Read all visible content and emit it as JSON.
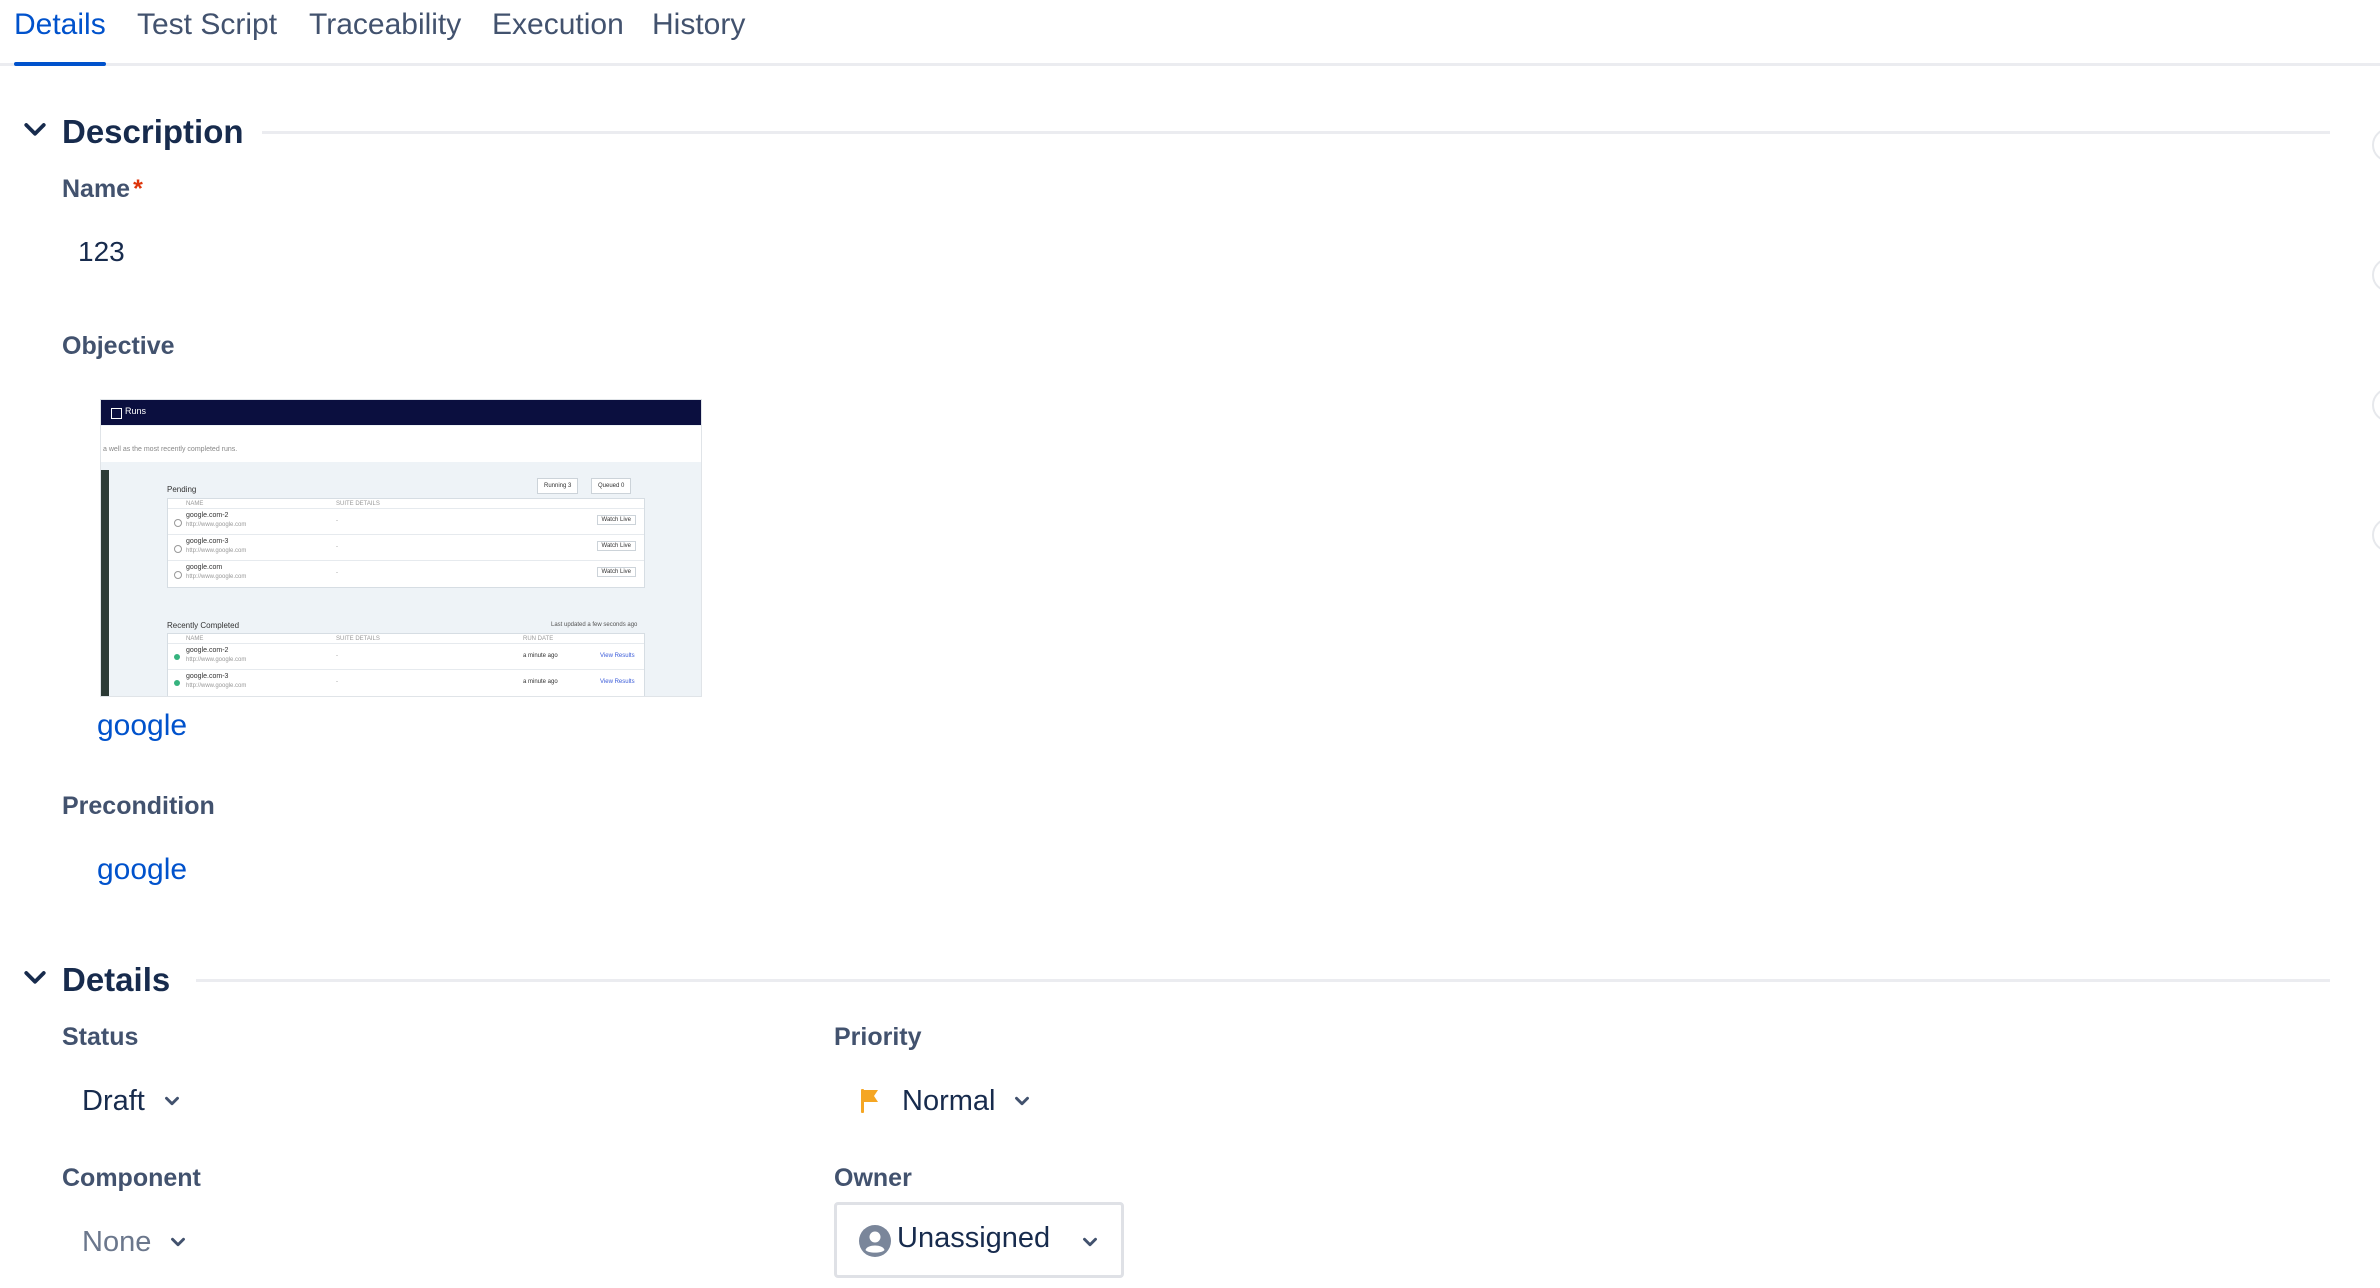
{
  "tabs": [
    {
      "label": "Details",
      "active": true
    },
    {
      "label": "Test Script",
      "active": false
    },
    {
      "label": "Traceability",
      "active": false
    },
    {
      "label": "Execution",
      "active": false
    },
    {
      "label": "History",
      "active": false
    }
  ],
  "description_section": {
    "title": "Description",
    "name": {
      "label": "Name",
      "required_mark": "*",
      "value": "123"
    },
    "objective": {
      "label": "Objective",
      "link_text": "google",
      "thumbnail": {
        "app_title": "Runs",
        "subtitle": "a well as the most recently completed runs.",
        "pending_title": "Pending",
        "running_label": "Running",
        "running_count": "3",
        "queued_label": "Queued",
        "queued_count": "0",
        "col_name": "NAME",
        "col_suite": "SUITE DETAILS",
        "col_run_date": "RUN DATE",
        "pending_rows": [
          {
            "name": "google.com-2",
            "url": "http://www.google.com",
            "suite": "-",
            "action": "Watch Live"
          },
          {
            "name": "google.com-3",
            "url": "http://www.google.com",
            "suite": "-",
            "action": "Watch Live"
          },
          {
            "name": "google.com",
            "url": "http://www.google.com",
            "suite": "-",
            "action": "Watch Live"
          }
        ],
        "recent_title": "Recently Completed",
        "recent_updated": "Last updated a few seconds ago",
        "recent_rows": [
          {
            "name": "google.com-2",
            "url": "http://www.google.com",
            "suite": "-",
            "date": "a minute ago",
            "action": "View Results"
          },
          {
            "name": "google.com-3",
            "url": "http://www.google.com",
            "suite": "-",
            "date": "a minute ago",
            "action": "View Results"
          }
        ]
      }
    },
    "precondition": {
      "label": "Precondition",
      "link_text": "google"
    }
  },
  "details_section": {
    "title": "Details",
    "status": {
      "label": "Status",
      "value": "Draft"
    },
    "priority": {
      "label": "Priority",
      "value": "Normal",
      "flag_color": "#f5a623"
    },
    "component": {
      "label": "Component",
      "value": "None"
    },
    "owner": {
      "label": "Owner",
      "value": "Unassigned"
    }
  },
  "colors": {
    "accent": "#0052cc",
    "text": "#172b4d",
    "label": "#42526e",
    "required": "#de350b"
  }
}
